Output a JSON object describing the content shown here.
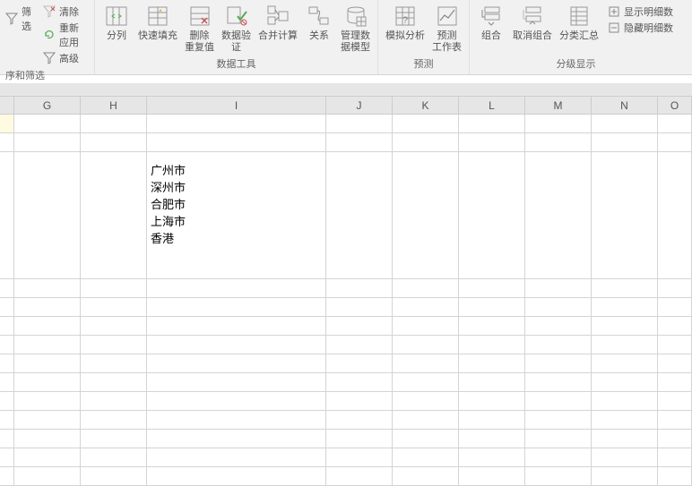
{
  "ribbon": {
    "groups": {
      "sortfilter": {
        "label": "序和筛选",
        "items": {
          "clear": "清除",
          "reapply": "重新应用",
          "advanced": "高级",
          "filter": "筛选"
        }
      },
      "datatools": {
        "label": "数据工具",
        "items": {
          "texttocolumns": "分列",
          "flashfill": "快速填充",
          "removedupes": "删除\n重复值",
          "validation": "数据验\n证",
          "consolidate": "合并计算",
          "relationships": "关系",
          "datamodel": "管理数\n据模型"
        }
      },
      "forecast": {
        "label": "预测",
        "items": {
          "whatif": "模拟分析",
          "forecastsheet": "预测\n工作表"
        }
      },
      "outline": {
        "label": "分级显示",
        "items": {
          "group": "组合",
          "ungroup": "取消组合",
          "subtotal": "分类汇总",
          "showdetail": "显示明细数",
          "hidedetail": "隐藏明细数"
        }
      }
    }
  },
  "columns": [
    "G",
    "H",
    "I",
    "J",
    "K",
    "L",
    "M",
    "N",
    "O"
  ],
  "cellI3": [
    "广州市",
    "深州市",
    "合肥市",
    "上海市",
    "香港"
  ]
}
